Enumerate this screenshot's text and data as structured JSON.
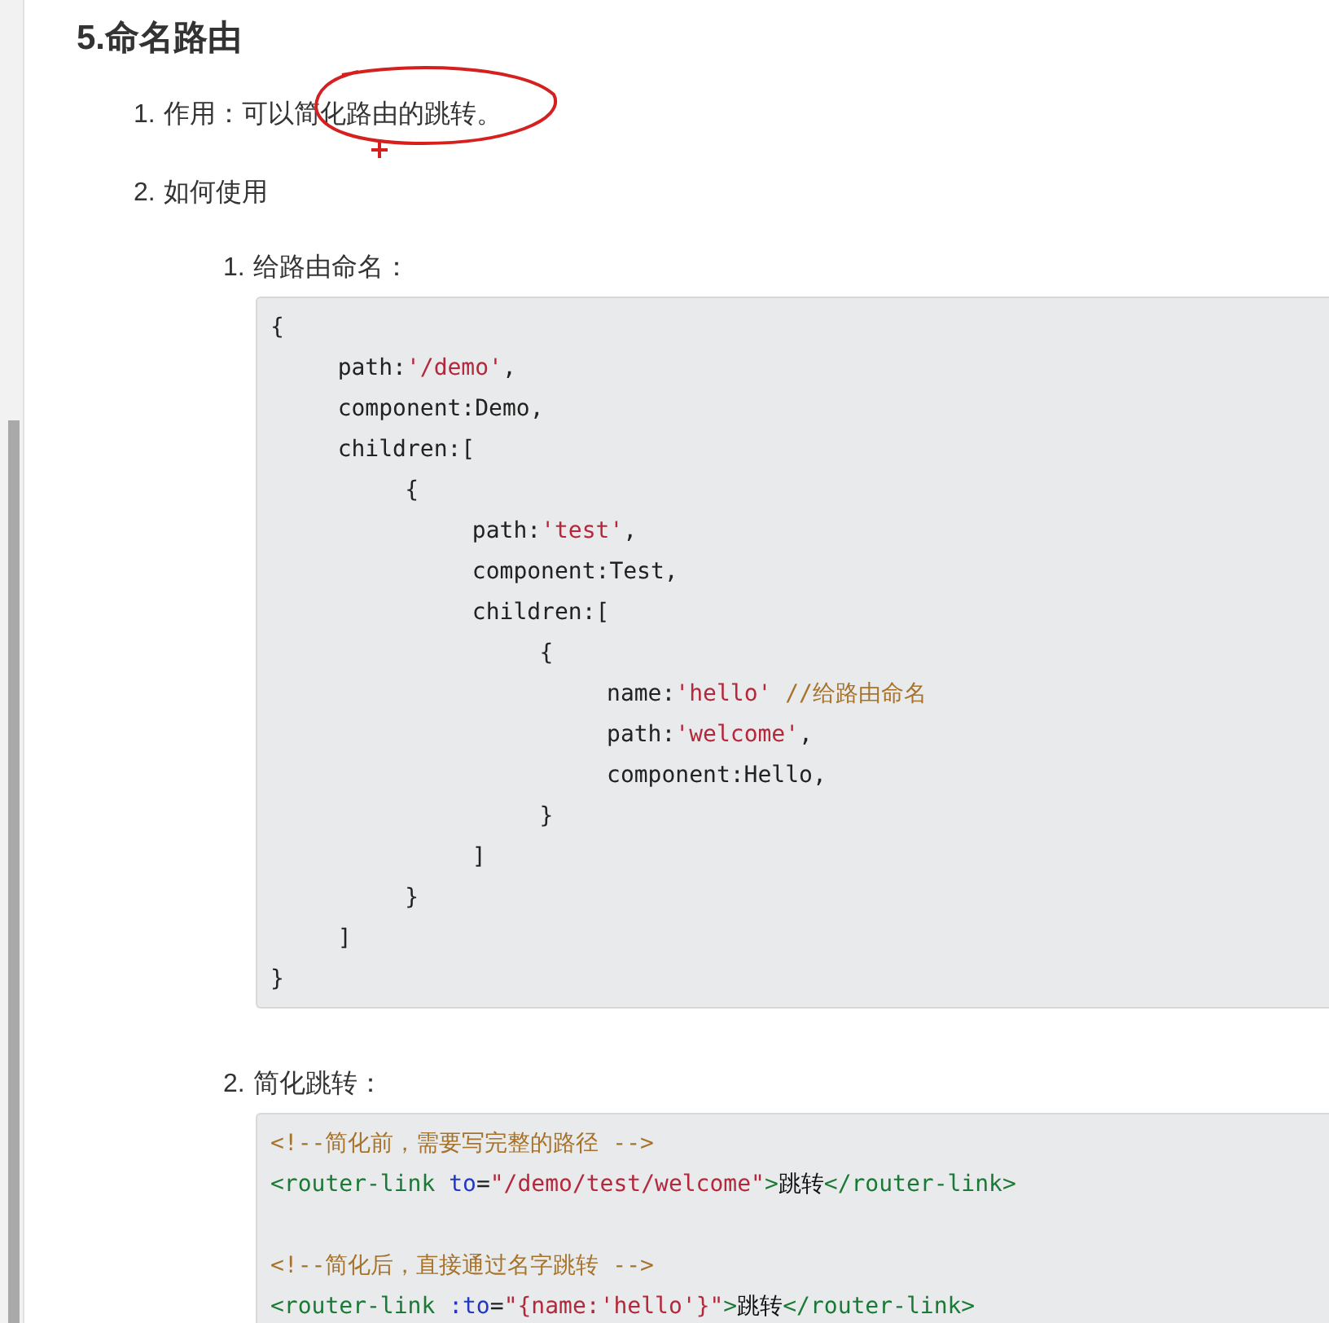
{
  "heading": "5.命名路由",
  "items": [
    {
      "number": "1.",
      "text": "作用：可以简化路由的跳转。"
    },
    {
      "number": "2.",
      "text": "如何使用",
      "children": [
        {
          "number": "1.",
          "text": "给路由命名：",
          "code": [
            {
              "kind": "code",
              "tokens": [
                {
                  "kind": "plain",
                  "text": "{"
                }
              ]
            },
            {
              "kind": "code",
              "tokens": [
                {
                  "kind": "plain",
                  "text": "\tpath:"
                },
                {
                  "kind": "string",
                  "text": "'/demo'"
                },
                {
                  "kind": "plain",
                  "text": ","
                }
              ]
            },
            {
              "kind": "code",
              "tokens": [
                {
                  "kind": "plain",
                  "text": "\tcomponent:Demo,"
                }
              ]
            },
            {
              "kind": "code",
              "tokens": [
                {
                  "kind": "plain",
                  "text": "\tchildren:["
                }
              ]
            },
            {
              "kind": "code",
              "tokens": [
                {
                  "kind": "plain",
                  "text": "\t\t{"
                }
              ]
            },
            {
              "kind": "code",
              "tokens": [
                {
                  "kind": "plain",
                  "text": "\t\t\tpath:"
                },
                {
                  "kind": "string",
                  "text": "'test'"
                },
                {
                  "kind": "plain",
                  "text": ","
                }
              ]
            },
            {
              "kind": "code",
              "tokens": [
                {
                  "kind": "plain",
                  "text": "\t\t\tcomponent:Test,"
                }
              ]
            },
            {
              "kind": "code",
              "tokens": [
                {
                  "kind": "plain",
                  "text": "\t\t\tchildren:["
                }
              ]
            },
            {
              "kind": "code",
              "tokens": [
                {
                  "kind": "plain",
                  "text": "\t\t\t\t{"
                }
              ]
            },
            {
              "kind": "code",
              "tokens": [
                {
                  "kind": "plain",
                  "text": "\t\t\t\t\tname:"
                },
                {
                  "kind": "string",
                  "text": "'hello'"
                },
                {
                  "kind": "comment",
                  "text": " //给路由命名"
                }
              ]
            },
            {
              "kind": "code",
              "tokens": [
                {
                  "kind": "plain",
                  "text": "\t\t\t\t\tpath:"
                },
                {
                  "kind": "string",
                  "text": "'welcome'"
                },
                {
                  "kind": "plain",
                  "text": ","
                }
              ]
            },
            {
              "kind": "code",
              "tokens": [
                {
                  "kind": "plain",
                  "text": "\t\t\t\t\tcomponent:Hello,"
                }
              ]
            },
            {
              "kind": "code",
              "tokens": [
                {
                  "kind": "plain",
                  "text": "\t\t\t\t}"
                }
              ]
            },
            {
              "kind": "code",
              "tokens": [
                {
                  "kind": "plain",
                  "text": "\t\t\t]"
                }
              ]
            },
            {
              "kind": "code",
              "tokens": [
                {
                  "kind": "plain",
                  "text": "\t\t}"
                }
              ]
            },
            {
              "kind": "code",
              "tokens": [
                {
                  "kind": "plain",
                  "text": "\t]"
                }
              ]
            },
            {
              "kind": "code",
              "tokens": [
                {
                  "kind": "plain",
                  "text": "}"
                }
              ]
            }
          ]
        },
        {
          "number": "2.",
          "text": "简化跳转：",
          "code": [
            {
              "kind": "code",
              "tokens": [
                {
                  "kind": "comment",
                  "text": "<!--简化前，需要写完整的路径 -->"
                }
              ]
            },
            {
              "kind": "code",
              "tokens": [
                {
                  "kind": "tag",
                  "text": "<router-link "
                },
                {
                  "kind": "attr",
                  "text": "to"
                },
                {
                  "kind": "plain",
                  "text": "="
                },
                {
                  "kind": "string",
                  "text": "\"/demo/test/welcome\""
                },
                {
                  "kind": "tag",
                  "text": ">"
                },
                {
                  "kind": "text",
                  "text": "跳转"
                },
                {
                  "kind": "tag",
                  "text": "</router-link>"
                }
              ]
            },
            {
              "kind": "blank"
            },
            {
              "kind": "code",
              "tokens": [
                {
                  "kind": "comment",
                  "text": "<!--简化后，直接通过名字跳转 -->"
                }
              ]
            },
            {
              "kind": "code",
              "tokens": [
                {
                  "kind": "tag",
                  "text": "<router-link "
                },
                {
                  "kind": "attr",
                  "text": ":to"
                },
                {
                  "kind": "plain",
                  "text": "="
                },
                {
                  "kind": "string",
                  "text": "\"{name:'hello'}\""
                },
                {
                  "kind": "tag",
                  "text": ">"
                },
                {
                  "kind": "text",
                  "text": "跳转"
                },
                {
                  "kind": "tag",
                  "text": "</router-link>"
                }
              ]
            }
          ]
        }
      ]
    }
  ]
}
